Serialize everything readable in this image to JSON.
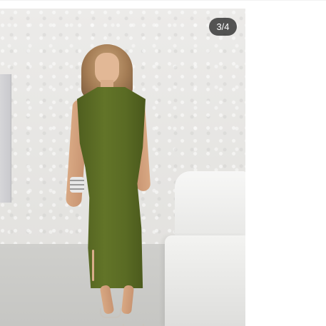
{
  "gallery": {
    "image_alt": "",
    "counter_text": "3/4",
    "current_index": 3,
    "total_images": 4,
    "dress_color": "#5a6b24"
  }
}
